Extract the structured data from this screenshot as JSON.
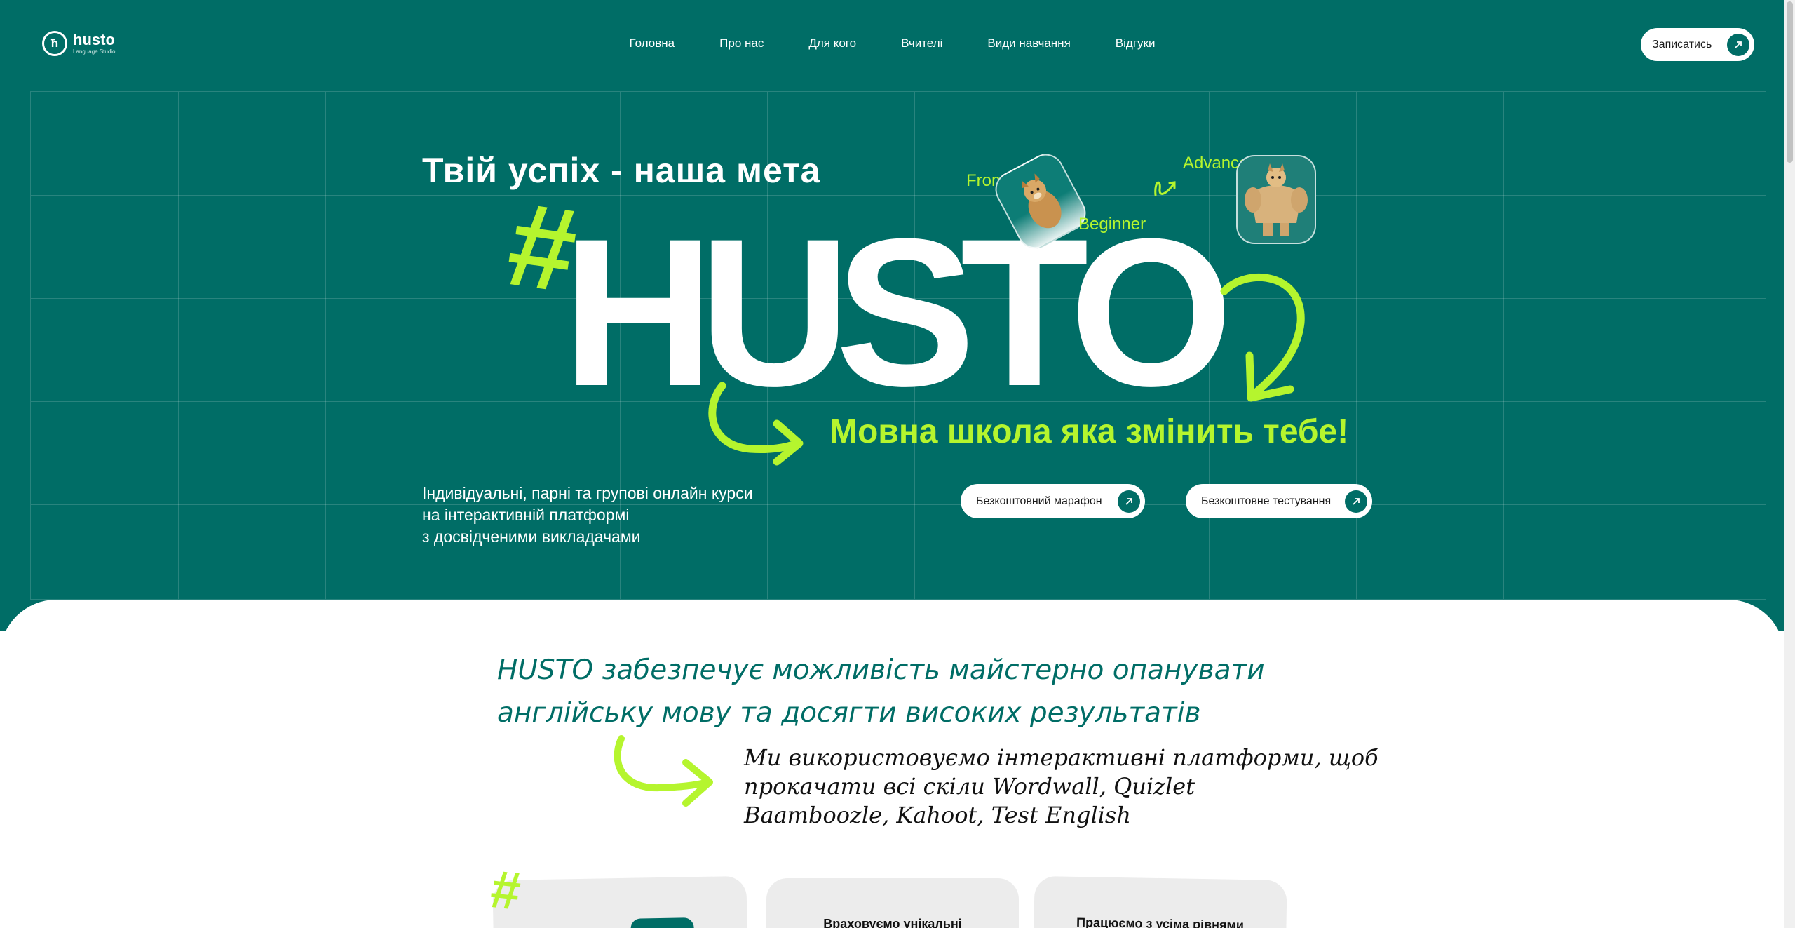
{
  "brand": {
    "name": "husto",
    "sub": "Language Studio",
    "mark": "ħ"
  },
  "nav": {
    "items": [
      {
        "label": "Головна"
      },
      {
        "label": "Про нас"
      },
      {
        "label": "Для кого"
      },
      {
        "label": "Вчителі"
      },
      {
        "label": "Види навчання"
      },
      {
        "label": "Відгуки"
      }
    ],
    "signup_label": "Записатись"
  },
  "hero": {
    "tagline": "Твій успіх - наша мета",
    "big_title": "HUSTO",
    "hash": "#",
    "slogan": "Мовна школа яка змінить тебе!",
    "description": [
      "Індивідуальні, парні та групові онлайн курси",
      "на інтерактивній платформі",
      "з досвідченими викладачами"
    ],
    "marathon_label": "Безкоштовний марафон",
    "testing_label": "Безкоштовне тестування",
    "meme": {
      "from": "From",
      "beginner": "Beginner",
      "advanced": "Advanced"
    }
  },
  "about": {
    "headline": [
      "HUSTO забезпечує можливість майстерно опанувати",
      "англійську мову та досягти високих результатів"
    ],
    "subtext": [
      "Ми використовуємо інтерактивні платформи, щоб",
      "прокачати всі скіли Wordwall, Quizlet",
      "Baamboozle, Kahoot, Test English"
    ],
    "hash": "#",
    "cards": [
      {
        "title": ""
      },
      {
        "title": "Враховуємо унікальні"
      },
      {
        "title": "Працюємо з усіма рівнями"
      }
    ]
  },
  "colors": {
    "primary": "#006d66",
    "accent": "#b5f52e",
    "white": "#ffffff"
  },
  "icons": {
    "arrow": "arrow-up-right-icon"
  }
}
